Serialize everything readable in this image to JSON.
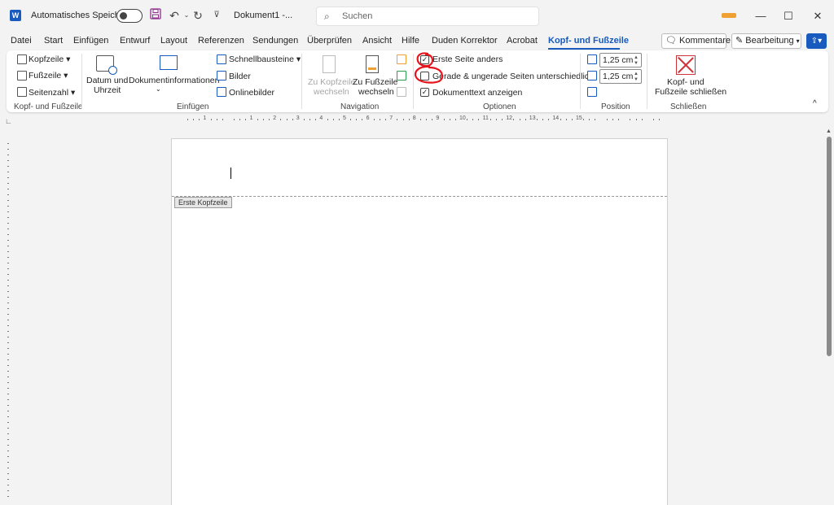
{
  "titlebar": {
    "app_logo": "W",
    "autosave_label": "Automatisches Speichern",
    "document_title": "Dokument1 -...",
    "search_placeholder": "Suchen",
    "icons": [
      "save-icon",
      "undo-icon",
      "redo-icon",
      "customize-icon"
    ],
    "window_buttons": {
      "minimize": "—",
      "maximize": "☐",
      "close": "✕"
    }
  },
  "tabs": [
    {
      "label": "Datei"
    },
    {
      "label": "Start"
    },
    {
      "label": "Einfügen"
    },
    {
      "label": "Entwurf"
    },
    {
      "label": "Layout"
    },
    {
      "label": "Referenzen"
    },
    {
      "label": "Sendungen"
    },
    {
      "label": "Überprüfen"
    },
    {
      "label": "Ansicht"
    },
    {
      "label": "Hilfe"
    },
    {
      "label": "Duden Korrektor"
    },
    {
      "label": "Acrobat"
    },
    {
      "label": "Kopf- und Fußzeile",
      "active": true
    }
  ],
  "tab_actions": {
    "comments": "Kommentare",
    "editing": "Bearbeitung"
  },
  "ribbon": {
    "group_header_footer": {
      "label": "Kopf- und Fußzeile",
      "header": "Kopfzeile",
      "footer": "Fußzeile",
      "page_number": "Seitenzahl"
    },
    "group_insert": {
      "label": "Einfügen",
      "date_line1": "Datum und",
      "date_line2": "Uhrzeit",
      "docinfo": "Dokumentinformationen",
      "quick_parts": "Schnellbausteine",
      "pictures": "Bilder",
      "online_pictures": "Onlinebilder"
    },
    "group_navigation": {
      "label": "Navigation",
      "goto_header_l1": "Zu Kopfzeile",
      "goto_header_l2": "wechseln",
      "goto_footer_l1": "Zu Fußzeile",
      "goto_footer_l2": "wechseln"
    },
    "group_options": {
      "label": "Optionen",
      "different_first": {
        "label": "Erste Seite anders",
        "checked": true
      },
      "odd_even": {
        "label": "Gerade & ungerade Seiten unterschiedlich",
        "checked": false
      },
      "show_text": {
        "label": "Dokumenttext anzeigen",
        "checked": true
      }
    },
    "group_position": {
      "label": "Position",
      "header_from_top": "1,25 cm",
      "footer_from_bottom": "1,25 cm"
    },
    "group_close": {
      "label": "Schließen",
      "close_l1": "Kopf- und",
      "close_l2": "Fußzeile schließen"
    }
  },
  "ruler": {
    "numbers": [
      "1",
      "1",
      "2",
      "3",
      "4",
      "5",
      "6",
      "7",
      "8",
      "9",
      "10",
      "11",
      "12",
      "13",
      "14",
      "15"
    ]
  },
  "document": {
    "header_tag": "Erste Kopfzeile"
  },
  "colors": {
    "accent": "#185abd",
    "annotation": "#e8141d",
    "close": "#d13438"
  }
}
